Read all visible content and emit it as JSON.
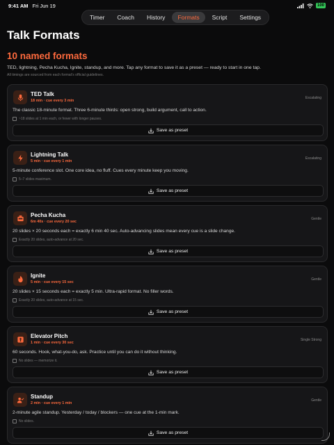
{
  "status_bar": {
    "time": "9:41 AM",
    "date": "Fri Jun 19",
    "battery": "100"
  },
  "tabs": [
    "Timer",
    "Coach",
    "History",
    "Formats",
    "Script",
    "Settings"
  ],
  "active_tab": "Formats",
  "page": {
    "title": "Talk Formats",
    "headline": "10 named formats",
    "intro": "TED, lightning, Pecha Kucha, Ignite, standup, and more. Tap any format to save it as a preset — ready to start in one tap.",
    "sources_note": "All timings are sourced from each format's official guidelines."
  },
  "save_label": "Save as preset",
  "colors": {
    "accent": "#ff6a3d",
    "background": "#0b0b0c",
    "card": "#161618"
  },
  "formats": [
    {
      "icon": "microphone-icon",
      "name": "TED Talk",
      "meta": "18 min · cue every 3 min",
      "tag": "Escalating",
      "description": "The classic 18-minute format. Three 6-minute thirds: open strong, build argument, call to action.",
      "note": "~18 slides at 1 min each, or fewer with longer pauses."
    },
    {
      "icon": "lightning-icon",
      "name": "Lightning Talk",
      "meta": "5 min · cue every 1 min",
      "tag": "Escalating",
      "description": "5-minute conference slot. One core idea, no fluff. Cues every minute keep you moving.",
      "note": "5–7 slides maximum."
    },
    {
      "icon": "presentation-icon",
      "name": "Pecha Kucha",
      "meta": "6m 40s · cue every 20 sec",
      "tag": "Gentle",
      "description": "20 slides × 20 seconds each = exactly 6 min 40 sec. Auto-advancing slides mean every cue is a slide change.",
      "note": "Exactly 20 slides, auto-advance at 20 sec."
    },
    {
      "icon": "flame-icon",
      "name": "Ignite",
      "meta": "5 min · cue every 15 sec",
      "tag": "Gentle",
      "description": "20 slides × 15 seconds each = exactly 5 min. Ultra-rapid format. No filler words.",
      "note": "Exactly 20 slides, auto-advance at 15 sec."
    },
    {
      "icon": "arrow-up-icon",
      "name": "Elevator Pitch",
      "meta": "1 min · cue every 30 sec",
      "tag": "Single Strong",
      "description": "60 seconds. Hook, what-you-do, ask. Practice until you can do it without thinking.",
      "note": "No slides — memorize it."
    },
    {
      "icon": "person-check-icon",
      "name": "Standup",
      "meta": "2 min · cue every 1 min",
      "tag": "Gentle",
      "description": "2-minute agile standup. Yesterday / today / blockers — one cue at the 1-min mark.",
      "note": "No slides."
    }
  ]
}
